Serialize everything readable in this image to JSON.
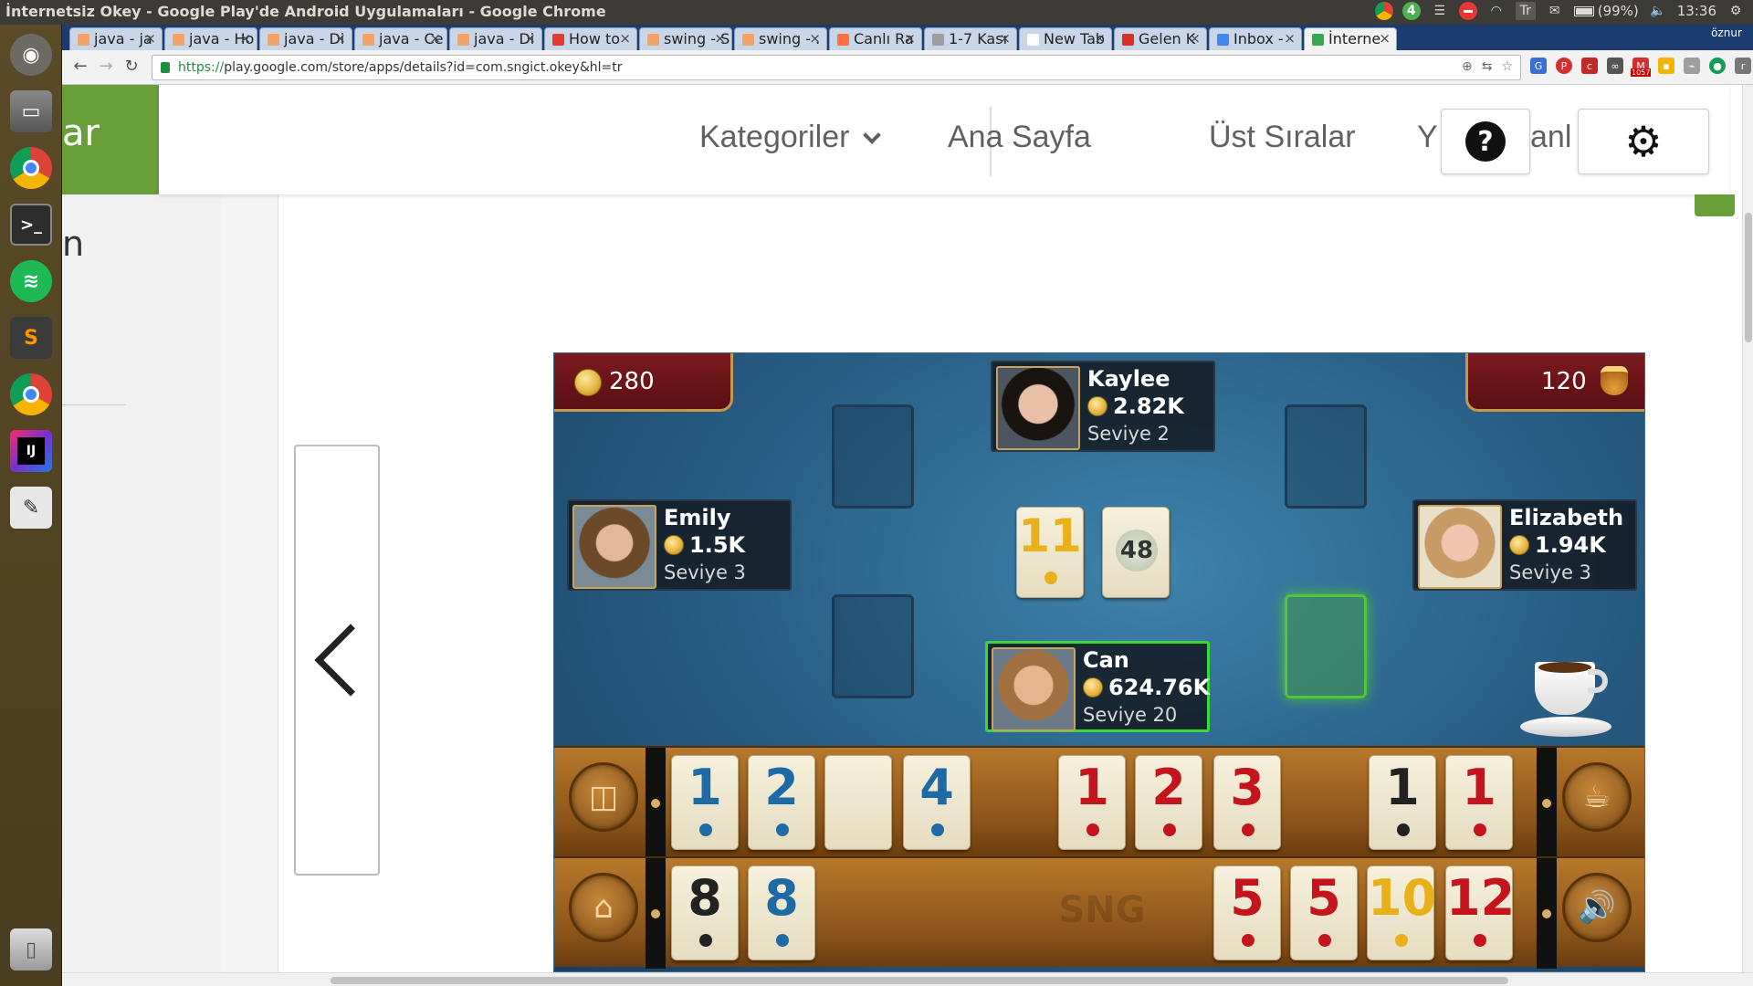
{
  "window": {
    "title": "İnternetsiz Okey - Google Play'de Android Uygulamaları - Google Chrome",
    "clock": "13:36",
    "battery": "(99%)",
    "keyboard": "Tr",
    "notification_count": "4"
  },
  "launcher": {
    "apps": [
      "ubuntu-dash-icon",
      "files-icon",
      "chrome-icon",
      "terminal-icon",
      "spotify-icon",
      "sublime-icon",
      "chrome-icon",
      "intellij-icon",
      "text-editor-icon",
      "trash-icon"
    ]
  },
  "tabs": [
    {
      "label": "java - ja",
      "color": "#f4a261"
    },
    {
      "label": "java - Ho",
      "color": "#f4a261"
    },
    {
      "label": "java - Di",
      "color": "#f4a261"
    },
    {
      "label": "java - Ce",
      "color": "#f4a261"
    },
    {
      "label": "java - Di",
      "color": "#f4a261"
    },
    {
      "label": "How to",
      "color": "#e53935"
    },
    {
      "label": "swing - S",
      "color": "#f4a261"
    },
    {
      "label": "swing - .",
      "color": "#f4a261"
    },
    {
      "label": "Canlı Ra",
      "color": "#ff7043"
    },
    {
      "label": "1-7 Kası",
      "color": "#9e9e9e"
    },
    {
      "label": "New Tab",
      "color": "#ffffff"
    },
    {
      "label": "Gelen K",
      "color": "#d93025"
    },
    {
      "label": "Inbox - ",
      "color": "#4285f4"
    },
    {
      "label": "İnterne",
      "color": "#34a853"
    }
  ],
  "user_chip": "öznur",
  "address_bar": {
    "scheme": "https://",
    "host_path": "play.google.com/store/apps/details?id=com.sngict.okey&hl=tr"
  },
  "extensions_badge": "1057",
  "store": {
    "brand_partial": "ar",
    "side_partial": "n",
    "nav": {
      "categories": "Kategoriler",
      "home": "Ana Sayfa",
      "top_charts": "Üst Sıralar",
      "new_releases_partial_1": "Y",
      "new_releases_partial_2": "anl"
    },
    "help_glyph": "?",
    "settings_glyph": "⚙"
  },
  "game": {
    "left_score": "280",
    "right_score": "120",
    "players": {
      "top": {
        "name": "Kaylee",
        "coins": "2.82K",
        "level": "Seviye 2"
      },
      "left": {
        "name": "Emily",
        "coins": "1.5K",
        "level": "Seviye 3"
      },
      "right": {
        "name": "Elizabeth",
        "coins": "1.94K",
        "level": "Seviye 3"
      },
      "bottom": {
        "name": "Can",
        "coins": "624.76K",
        "level": "Seviye 20"
      }
    },
    "indicator_tile": {
      "number": "11",
      "color": "yellow"
    },
    "deck_count": "48",
    "rack_top": [
      {
        "number": "1",
        "color": "blue"
      },
      {
        "number": "2",
        "color": "blue"
      },
      {
        "number": "",
        "color": "blank"
      },
      {
        "number": "4",
        "color": "blue"
      },
      {
        "number": "1",
        "color": "red"
      },
      {
        "number": "2",
        "color": "red"
      },
      {
        "number": "3",
        "color": "red"
      },
      {
        "number": "1",
        "color": "black"
      },
      {
        "number": "1",
        "color": "red"
      }
    ],
    "rack_bottom": [
      {
        "number": "8",
        "color": "black"
      },
      {
        "number": "8",
        "color": "blue"
      },
      {
        "number": "5",
        "color": "red"
      },
      {
        "number": "5",
        "color": "red"
      },
      {
        "number": "10",
        "color": "yellow"
      },
      {
        "number": "12",
        "color": "red"
      }
    ],
    "watermark": "SNG"
  }
}
